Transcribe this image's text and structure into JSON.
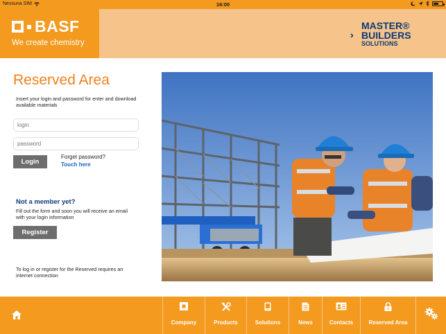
{
  "status_bar": {
    "carrier": "Nessuna SIM",
    "time": "16:00"
  },
  "header": {
    "basf_wordmark": "BASF",
    "basf_tagline": "We create chemistry",
    "partner_logo": {
      "line1": "MASTER®",
      "line2": "BUILDERS",
      "line3": "SOLUTIONS"
    }
  },
  "login": {
    "title": "Reserved Area",
    "intro": "Insert your login and password for enter and download available materials",
    "login_placeholder": "login",
    "password_placeholder": "password",
    "login_button": "Login",
    "forgot_text": "Forget password?",
    "touch_link": "Touch here"
  },
  "register": {
    "title": "Not a member yet?",
    "text": "Fill out the form and soon you will receive an email with your login information",
    "button": "Register"
  },
  "footer_note": "To log in or register for the Reserved requires an internet connection",
  "nav": {
    "items": [
      {
        "label": "Company",
        "icon": "building-icon"
      },
      {
        "label": "Products",
        "icon": "tools-icon"
      },
      {
        "label": "Solutions",
        "icon": "tablet-icon"
      },
      {
        "label": "News",
        "icon": "document-icon"
      },
      {
        "label": "Contacts",
        "icon": "contact-card-icon"
      },
      {
        "label": "Reserved Area",
        "icon": "lock-icon"
      }
    ]
  },
  "colors": {
    "brand_orange": "#f39a1f",
    "header_light": "#f6c38a",
    "title_orange": "#f0821e",
    "navy": "#0b3a7a",
    "link_blue": "#1565c0",
    "button_gray": "#6d6d6d"
  }
}
